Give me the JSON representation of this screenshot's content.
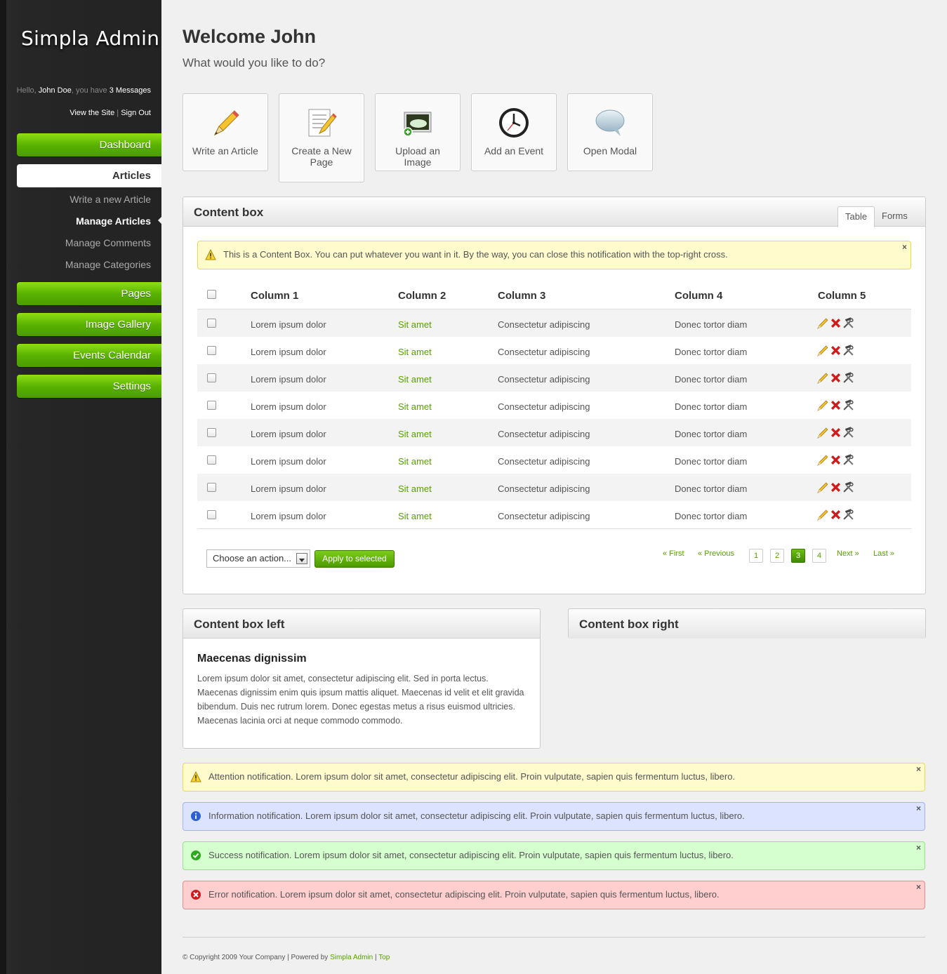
{
  "app": {
    "logo": "Simpla Admin"
  },
  "profile": {
    "hello": "Hello, ",
    "user_name": "John Doe",
    "you_have": ", you have ",
    "messages": "3 Messages",
    "view_site": "View the Site",
    "separator": " | ",
    "sign_out": "Sign Out"
  },
  "sidebar": {
    "dashboard": "Dashboard",
    "articles": "Articles",
    "sub_items": [
      "Write a new Article",
      "Manage Articles",
      "Manage Comments",
      "Manage Categories"
    ],
    "pages": "Pages",
    "image_gallery": "Image Gallery",
    "events_calendar": "Events Calendar",
    "settings": "Settings"
  },
  "header": {
    "title": "Welcome John",
    "subtitle": "What would you like to do?"
  },
  "shortcuts": [
    {
      "label": "Write an Article",
      "icon": "pencil-icon"
    },
    {
      "label": "Create a New Page",
      "icon": "new-page-icon"
    },
    {
      "label": "Upload an Image",
      "icon": "image-upload-icon"
    },
    {
      "label": "Add an Event",
      "icon": "clock-icon"
    },
    {
      "label": "Open Modal",
      "icon": "speech-bubble-icon"
    }
  ],
  "content_box": {
    "title": "Content box",
    "tabs": [
      "Table",
      "Forms"
    ],
    "active_tab": "Table",
    "notification": "This is a Content Box. You can put whatever you want in it. By the way, you can close this notification with the top-right cross.",
    "table": {
      "headers": [
        "Column 1",
        "Column 2",
        "Column 3",
        "Column 4",
        "Column 5"
      ],
      "rows": [
        [
          "Lorem ipsum dolor",
          "Sit amet",
          "Consectetur adipiscing",
          "Donec tortor diam"
        ],
        [
          "Lorem ipsum dolor",
          "Sit amet",
          "Consectetur adipiscing",
          "Donec tortor diam"
        ],
        [
          "Lorem ipsum dolor",
          "Sit amet",
          "Consectetur adipiscing",
          "Donec tortor diam"
        ],
        [
          "Lorem ipsum dolor",
          "Sit amet",
          "Consectetur adipiscing",
          "Donec tortor diam"
        ],
        [
          "Lorem ipsum dolor",
          "Sit amet",
          "Consectetur adipiscing",
          "Donec tortor diam"
        ],
        [
          "Lorem ipsum dolor",
          "Sit amet",
          "Consectetur adipiscing",
          "Donec tortor diam"
        ],
        [
          "Lorem ipsum dolor",
          "Sit amet",
          "Consectetur adipiscing",
          "Donec tortor diam"
        ],
        [
          "Lorem ipsum dolor",
          "Sit amet",
          "Consectetur adipiscing",
          "Donec tortor diam"
        ]
      ],
      "row_actions": [
        "edit-icon",
        "delete-icon",
        "settings-icon"
      ]
    },
    "bulk_action": {
      "selected": "Choose an action...",
      "apply_label": "Apply to selected"
    },
    "pagination": {
      "first": "« First",
      "previous": "« Previous",
      "pages": [
        "1",
        "2",
        "3",
        "4"
      ],
      "current": "3",
      "next": "Next »",
      "last": "Last »"
    }
  },
  "content_box_left": {
    "title": "Content box left",
    "heading": "Maecenas dignissim",
    "body": "Lorem ipsum dolor sit amet, consectetur adipiscing elit. Sed in porta lectus. Maecenas dignissim enim quis ipsum mattis aliquet. Maecenas id velit et elit gravida bibendum. Duis nec rutrum lorem. Donec egestas metus a risus euismod ultricies. Maecenas lacinia orci at neque commodo commodo."
  },
  "content_box_right": {
    "title": "Content box right"
  },
  "notifications": [
    {
      "type": "attention",
      "text": "Attention notification. Lorem ipsum dolor sit amet, consectetur adipiscing elit. Proin vulputate, sapien quis fermentum luctus, libero."
    },
    {
      "type": "information",
      "text": "Information notification. Lorem ipsum dolor sit amet, consectetur adipiscing elit. Proin vulputate, sapien quis fermentum luctus, libero."
    },
    {
      "type": "success",
      "text": "Success notification. Lorem ipsum dolor sit amet, consectetur adipiscing elit. Proin vulputate, sapien quis fermentum luctus, libero."
    },
    {
      "type": "error",
      "text": "Error notification. Lorem ipsum dolor sit amet, consectetur adipiscing elit. Proin vulputate, sapien quis fermentum luctus, libero."
    }
  ],
  "close_glyph": "×",
  "footer": {
    "copyright": "© Copyright 2009 Your Company | Powered by ",
    "powered_by": "Simpla Admin",
    "separator": " | ",
    "top": "Top"
  },
  "colors": {
    "accent_green": "#57a000",
    "sidebar_bg": "#262626",
    "attention_bg": "#fffbcc",
    "information_bg": "#dbe3ff",
    "success_bg": "#d5ffce",
    "error_bg": "#ffcece"
  }
}
